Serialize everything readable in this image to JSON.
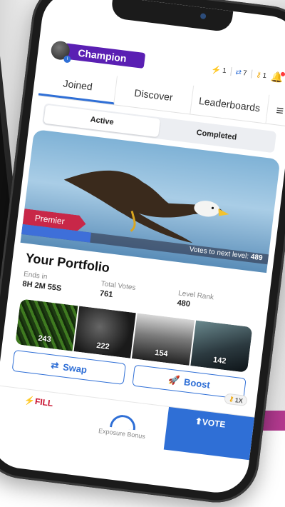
{
  "header": {
    "badge_label": "Champion",
    "counters": [
      {
        "icon": "bolt-icon",
        "value": "1"
      },
      {
        "icon": "swap-icon",
        "value": "7"
      },
      {
        "icon": "key-icon",
        "value": "1"
      }
    ]
  },
  "tabs": [
    {
      "label": "Joined",
      "active": true
    },
    {
      "label": "Discover",
      "active": false
    },
    {
      "label": "Leaderboards",
      "active": false
    }
  ],
  "segment": {
    "active": "Active",
    "inactive": "Completed"
  },
  "hero": {
    "tier_label": "Premier",
    "progress_prefix": "Votes to next level: ",
    "progress_value": "489",
    "progress_fraction": 0.28
  },
  "portfolio": {
    "title": "Your Portfolio",
    "stats": [
      {
        "label": "Ends in",
        "value": "8H 2M 55S"
      },
      {
        "label": "Total Votes",
        "value": "761"
      },
      {
        "label": "Level Rank",
        "value": "480"
      }
    ],
    "thumbnails": [
      "243",
      "222",
      "154",
      "142"
    ]
  },
  "actions": {
    "swap_label": "Swap",
    "boost_label": "Boost",
    "boost_tag": "1X"
  },
  "bottom_bar": {
    "fill_label": "FILL",
    "exposure_label": "Exposure Bonus",
    "vote_label": "VOTE"
  },
  "colors": {
    "accent": "#2f6fd6",
    "badge": "#5a1fb3",
    "premier": "#c82748",
    "fill": "#c8102e"
  }
}
